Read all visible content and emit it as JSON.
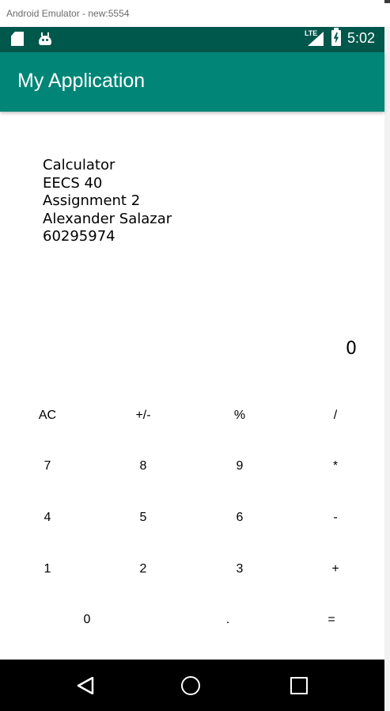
{
  "window": {
    "title": "Android Emulator - new:5554"
  },
  "status_bar": {
    "left_icons": [
      "sd-card-icon",
      "android-icon"
    ],
    "network_label": "LTE",
    "time": "5:02"
  },
  "app_bar": {
    "title": "My Application"
  },
  "info_lines": [
    "Calculator",
    "EECS 40",
    "Assignment 2",
    "Alexander Salazar",
    "60295974"
  ],
  "display": {
    "value": "0"
  },
  "keypad": {
    "row1": [
      "AC",
      "+/-",
      "%",
      "/"
    ],
    "row2": [
      "7",
      "8",
      "9",
      "*"
    ],
    "row3": [
      "4",
      "5",
      "6",
      "-"
    ],
    "row4": [
      "1",
      "2",
      "3",
      "+"
    ],
    "row5": [
      "0",
      ".",
      "="
    ]
  },
  "nav_bar": {
    "icons": [
      "back-icon",
      "home-icon",
      "recents-icon"
    ]
  },
  "colors": {
    "status_bar": "#00574b",
    "app_bar": "#008577",
    "nav_bar": "#000000"
  }
}
